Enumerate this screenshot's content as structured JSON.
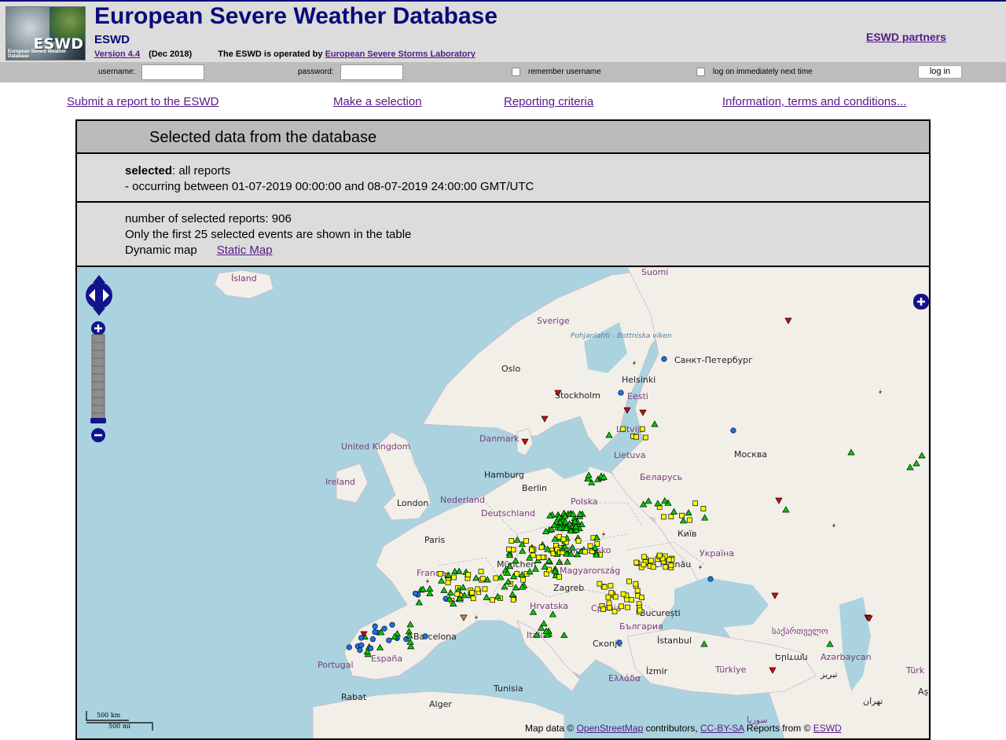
{
  "header": {
    "logo_text": "ESWD",
    "logo_subtext": "European Severe Weather Database",
    "title": "European Severe Weather Database",
    "abbr": "ESWD",
    "version_link": "Version 4.4",
    "version_date": "(Dec 2018)",
    "operated_by": "The ESWD is operated by",
    "operator_link": "European Severe Storms Laboratory",
    "partners_link": "ESWD partners"
  },
  "login": {
    "username_label": "username:",
    "password_label": "password:",
    "remember_label": "remember username",
    "auto_logon_label": "log on immediately next time",
    "login_button": "log in"
  },
  "nav": {
    "submit": "Submit a report to the ESWD",
    "selection": "Make a selection",
    "criteria": "Reporting criteria",
    "info": "Information, terms and conditions..."
  },
  "panel": {
    "title": "Selected data from the database",
    "selected_label": "selected",
    "selected_value": ": all reports",
    "period": "- occurring between 01-07-2019 00:00:00 and 08-07-2019 24:00:00 GMT/UTC",
    "count": "number of selected reports: 906",
    "shown_note": "Only the first 25 selected events are shown in the table",
    "dynamic_map": "Dynamic map",
    "static_map": "Static Map"
  },
  "map": {
    "place_labels": [
      "Ísland",
      "Suomi",
      "Sverige",
      "Pohjanlahti - Bottniska viken",
      "Oslo",
      "Stockholm",
      "Helsinki",
      "Санкт-Петербург",
      "Eesti",
      "Latvija",
      "Lietuva",
      "Danmark",
      "United Kingdom",
      "Ireland",
      "Hamburg",
      "Berlin",
      "Nederland",
      "London",
      "Polska",
      "Беларусь",
      "Москва",
      "Deutschland",
      "Київ",
      "Paris",
      "Slovensko",
      "Україна",
      "France",
      "München",
      "Magyarország",
      "Chișinău",
      "Zagreb",
      "Hrvatska",
      "Србија",
      "București",
      "България",
      "Barcelona",
      "España",
      "Portugal",
      "Italia",
      "Скопје",
      "İstanbul",
      "საქართველო",
      "Երևան",
      "Azərbaycan",
      "Ελλάδα",
      "İzmir",
      "Türkiye",
      "Rabat",
      "Alger",
      "Tunisia",
      "تبريز",
      "تهران",
      "سوريا",
      "Türk",
      "Aş"
    ],
    "scale_km": "500 km",
    "scale_mi": "500 mi",
    "attribution_prefix": "Map data ©",
    "attribution_osm": "OpenStreetMap",
    "attribution_mid": "contributors,",
    "attribution_license": "CC-BY-SA",
    "attribution_reports": "Reports from ©",
    "attribution_eswd": "ESWD",
    "report_types": {
      "hail": "#ffff00",
      "thunderstorm_wind": "#00cc00",
      "heavy_rain": "#1e6fe0",
      "tornado": "#e00000",
      "lightning": "#6b3a1a",
      "funnel": "#f08020"
    }
  }
}
